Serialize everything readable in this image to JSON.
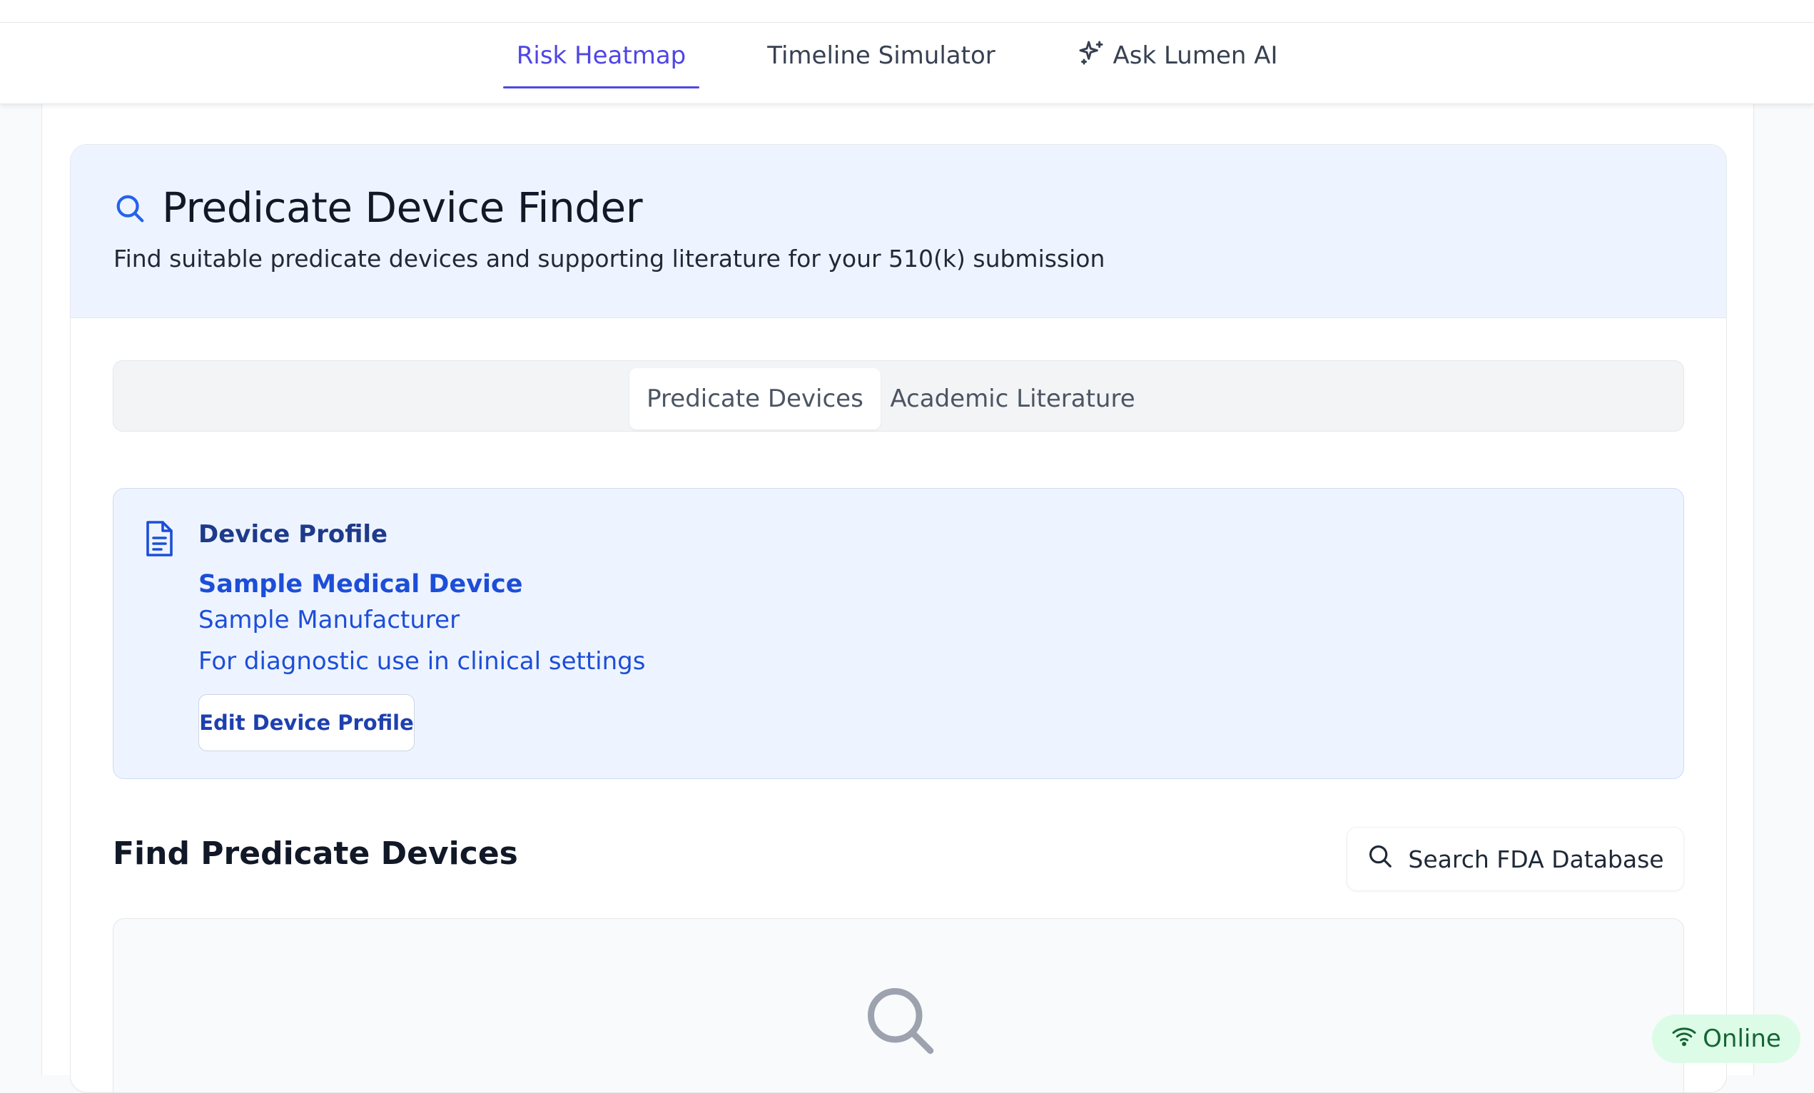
{
  "nav": {
    "tabs": [
      {
        "label": "Risk Heatmap",
        "active": true
      },
      {
        "label": "Timeline Simulator",
        "active": false
      },
      {
        "label": "Ask Lumen AI",
        "active": false,
        "icon": "sparkles-icon"
      }
    ]
  },
  "header": {
    "icon": "search-icon",
    "title": "Predicate Device Finder",
    "subtitle": "Find suitable predicate devices and supporting literature for your 510(k) submission"
  },
  "segment_tabs": [
    {
      "label": "Predicate Devices",
      "active": true
    },
    {
      "label": "Academic Literature",
      "active": false
    }
  ],
  "device_profile": {
    "icon": "document-icon",
    "heading": "Device Profile",
    "device_name": "Sample Medical Device",
    "manufacturer": "Sample Manufacturer",
    "intended_use": "For diagnostic use in clinical settings",
    "edit_label": "Edit Device Profile"
  },
  "predicates": {
    "section_title": "Find Predicate Devices",
    "search_button_label": "Search FDA Database",
    "empty_icon": "search-icon"
  },
  "status": {
    "label": "Online",
    "icon": "wifi-icon"
  },
  "colors": {
    "accent": "#4f46e5",
    "profile_text": "#1d4ed8",
    "header_bg": "#eef4ff",
    "online_bg": "#dcfce7",
    "online_text": "#166534"
  }
}
